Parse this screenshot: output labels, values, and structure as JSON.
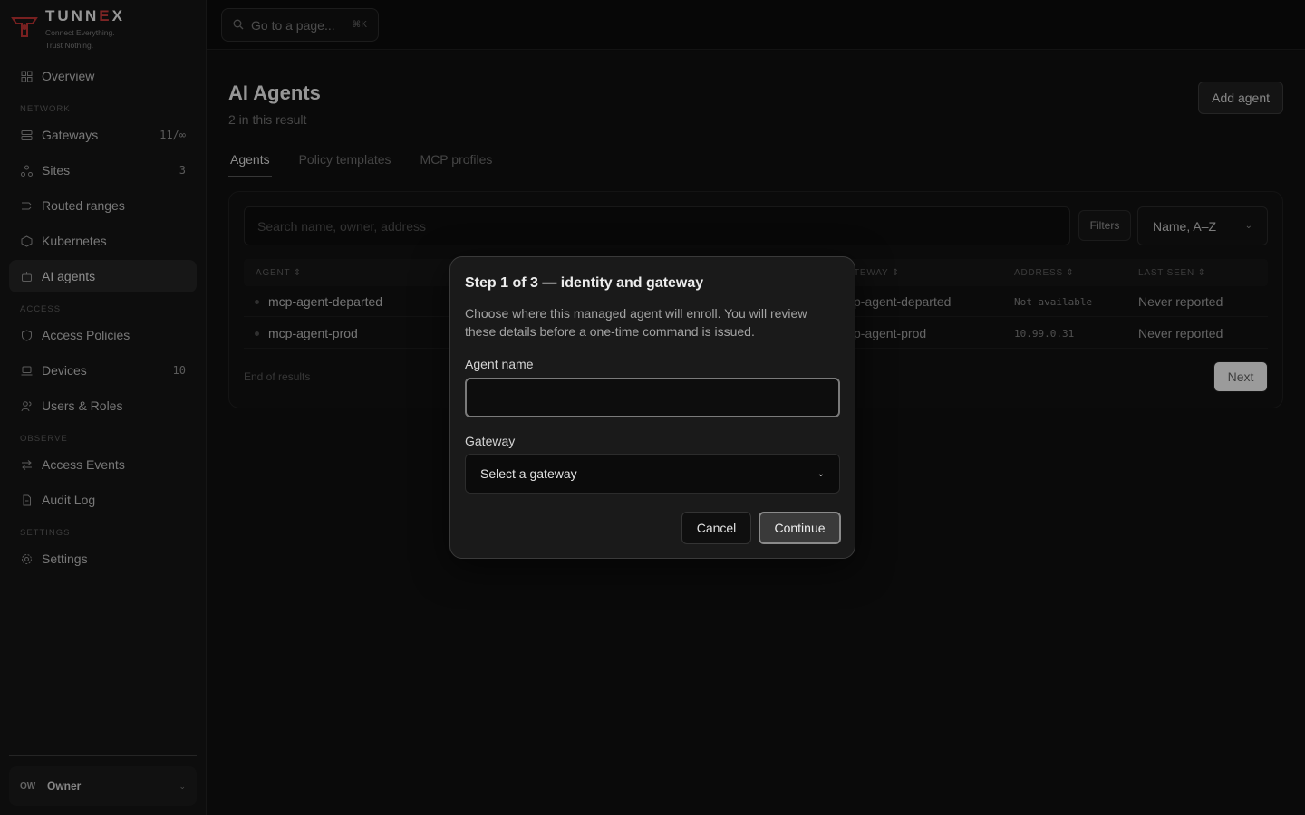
{
  "brand": {
    "name_main": "TUNN",
    "name_x": "E",
    "name_end": "X",
    "tagline_line1": "Connect Everything.",
    "tagline_line2": "Trust Nothing."
  },
  "search_bar": {
    "placeholder": "Go to a page...",
    "shortcut": "⌘K"
  },
  "sidebar": {
    "overview": "Overview",
    "sections": {
      "network": "NETWORK",
      "access": "ACCESS",
      "observe": "OBSERVE",
      "settings": "SETTINGS"
    },
    "items": {
      "gateways": {
        "label": "Gateways",
        "count": "11/∞"
      },
      "sites": {
        "label": "Sites",
        "count": "3"
      },
      "routed_ranges": {
        "label": "Routed ranges"
      },
      "kubernetes": {
        "label": "Kubernetes"
      },
      "ai_agents": {
        "label": "AI agents"
      },
      "access_policies": {
        "label": "Access Policies"
      },
      "devices": {
        "label": "Devices",
        "count": "10"
      },
      "users_roles": {
        "label": "Users & Roles"
      },
      "access_events": {
        "label": "Access Events"
      },
      "audit_log": {
        "label": "Audit Log"
      },
      "settings": {
        "label": "Settings"
      }
    },
    "user": {
      "initials": "OW",
      "name": "Owner"
    }
  },
  "page": {
    "title": "AI Agents",
    "subtitle": "2 in this result",
    "add_button": "Add agent",
    "tabs": [
      "Agents",
      "Policy templates",
      "MCP profiles"
    ]
  },
  "table": {
    "search_placeholder": "Search name, owner, address",
    "filters_label": "Filters",
    "sort_label": "Name, A–Z",
    "headers": {
      "agent": "AGENT ⇕",
      "gateway": "TEWAY ⇕",
      "address": "ADDRESS ⇕",
      "last_seen": "LAST SEEN ⇕"
    },
    "rows": [
      {
        "agent": "mcp-agent-departed",
        "gateway": "p-agent-departed",
        "address": "Not available",
        "last_seen": "Never reported"
      },
      {
        "agent": "mcp-agent-prod",
        "gateway": "p-agent-prod",
        "address": "10.99.0.31",
        "last_seen": "Never reported"
      }
    ],
    "end_text": "End of results",
    "next_label": "Next"
  },
  "modal": {
    "title": "Step 1 of 3 — identity and gateway",
    "description": "Choose where this managed agent will enroll. You will review these details before a one-time command is issued.",
    "agent_name_label": "Agent name",
    "agent_name_value": "",
    "gateway_label": "Gateway",
    "gateway_value": "Select a gateway",
    "cancel": "Cancel",
    "continue": "Continue"
  }
}
